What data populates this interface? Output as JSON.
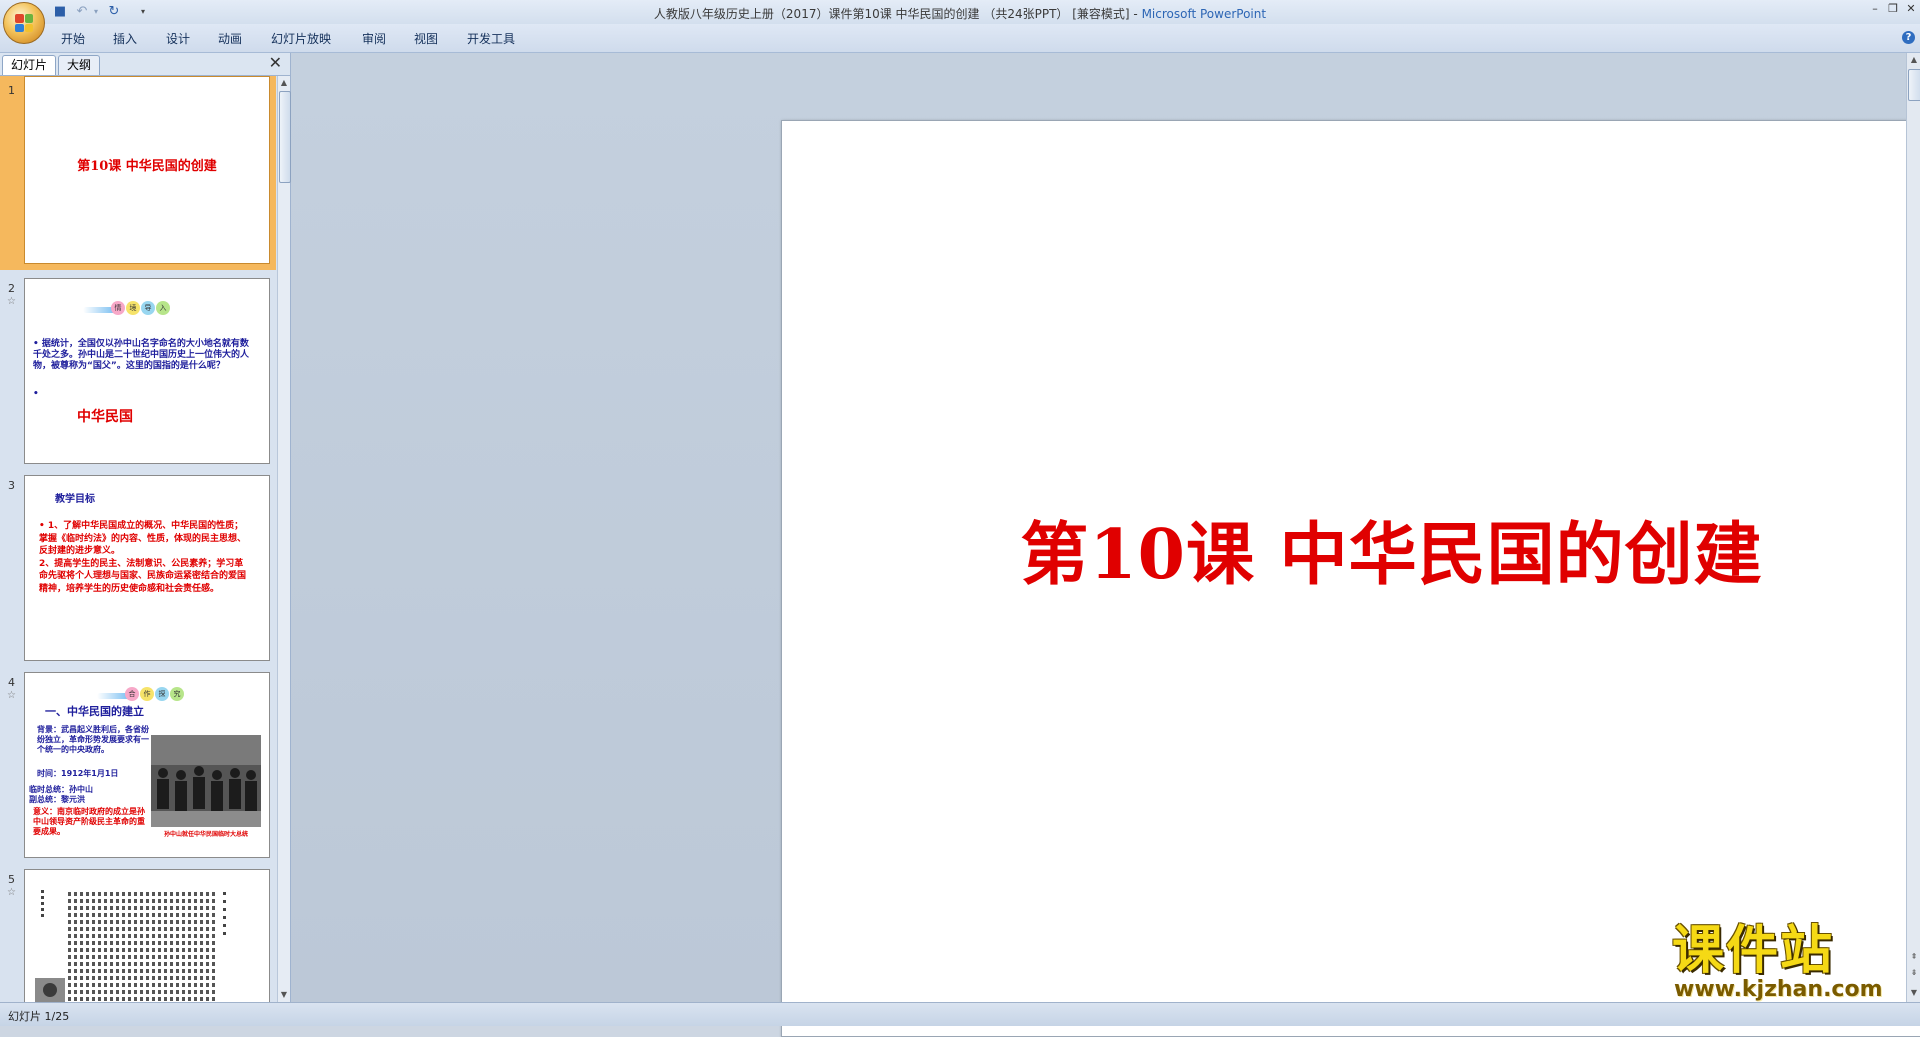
{
  "window": {
    "title": "人教版八年级历史上册（2017）课件第10课 中华民国的创建 （共24张PPT） [兼容模式] - ",
    "app_name": "Microsoft PowerPoint"
  },
  "ribbon": {
    "tabs": [
      "开始",
      "插入",
      "设计",
      "动画",
      "幻灯片放映",
      "审阅",
      "视图",
      "开发工具"
    ]
  },
  "panel": {
    "tabs": [
      "幻灯片",
      "大纲"
    ],
    "slides": [
      {
        "num": "1",
        "title": "第10课  中华民国的创建"
      },
      {
        "num": "2",
        "banner": [
          "情",
          "境",
          "导",
          "入"
        ],
        "body": "• 据统计，全国仅以孙中山名字命名的大小地名就有数千处之多。孙中山是二十世纪中国历史上一位伟大的人物，被尊称为“国父”。这里的国指的是什么呢？",
        "bullet2": "•",
        "answer": "中华民国"
      },
      {
        "num": "3",
        "heading": "教学目标",
        "body": "• 1、了解中华民国成立的概况、中华民国的性质；掌握《临时约法》的内容、性质，体现的民主思想、反封建的进步意义。\n2、提高学生的民主、法制意识、公民素养；学习革命先驱将个人理想与国家、民族命运紧密结合的爱国精神，培养学生的历史使命感和社会责任感。"
      },
      {
        "num": "4",
        "banner": [
          "合",
          "作",
          "探",
          "究"
        ],
        "heading": "一、中华民国的建立",
        "bg": "背景：武昌起义胜利后，各省纷纷独立，革命形势发展要求有一个统一的中央政府。",
        "time": "时间：1912年1月1日",
        "president": "临时总统：孙中山\n副总统：黎元洪",
        "meaning": "意义：南京临时政府的成立是孙中山领导资产阶级民主革命的重要成果。",
        "caption": "孙中山就任中华民国临时大总统"
      },
      {
        "num": "5"
      }
    ]
  },
  "slide": {
    "title": "第10课  中华民国的创建"
  },
  "status": {
    "text": "幻灯片 1/25"
  },
  "watermark": {
    "title": "课件站",
    "url": "www.kjzhan.com"
  },
  "colors": {
    "accent_red": "#e00000",
    "selection": "#f5b85d",
    "blue_text": "#1e1e9c"
  }
}
